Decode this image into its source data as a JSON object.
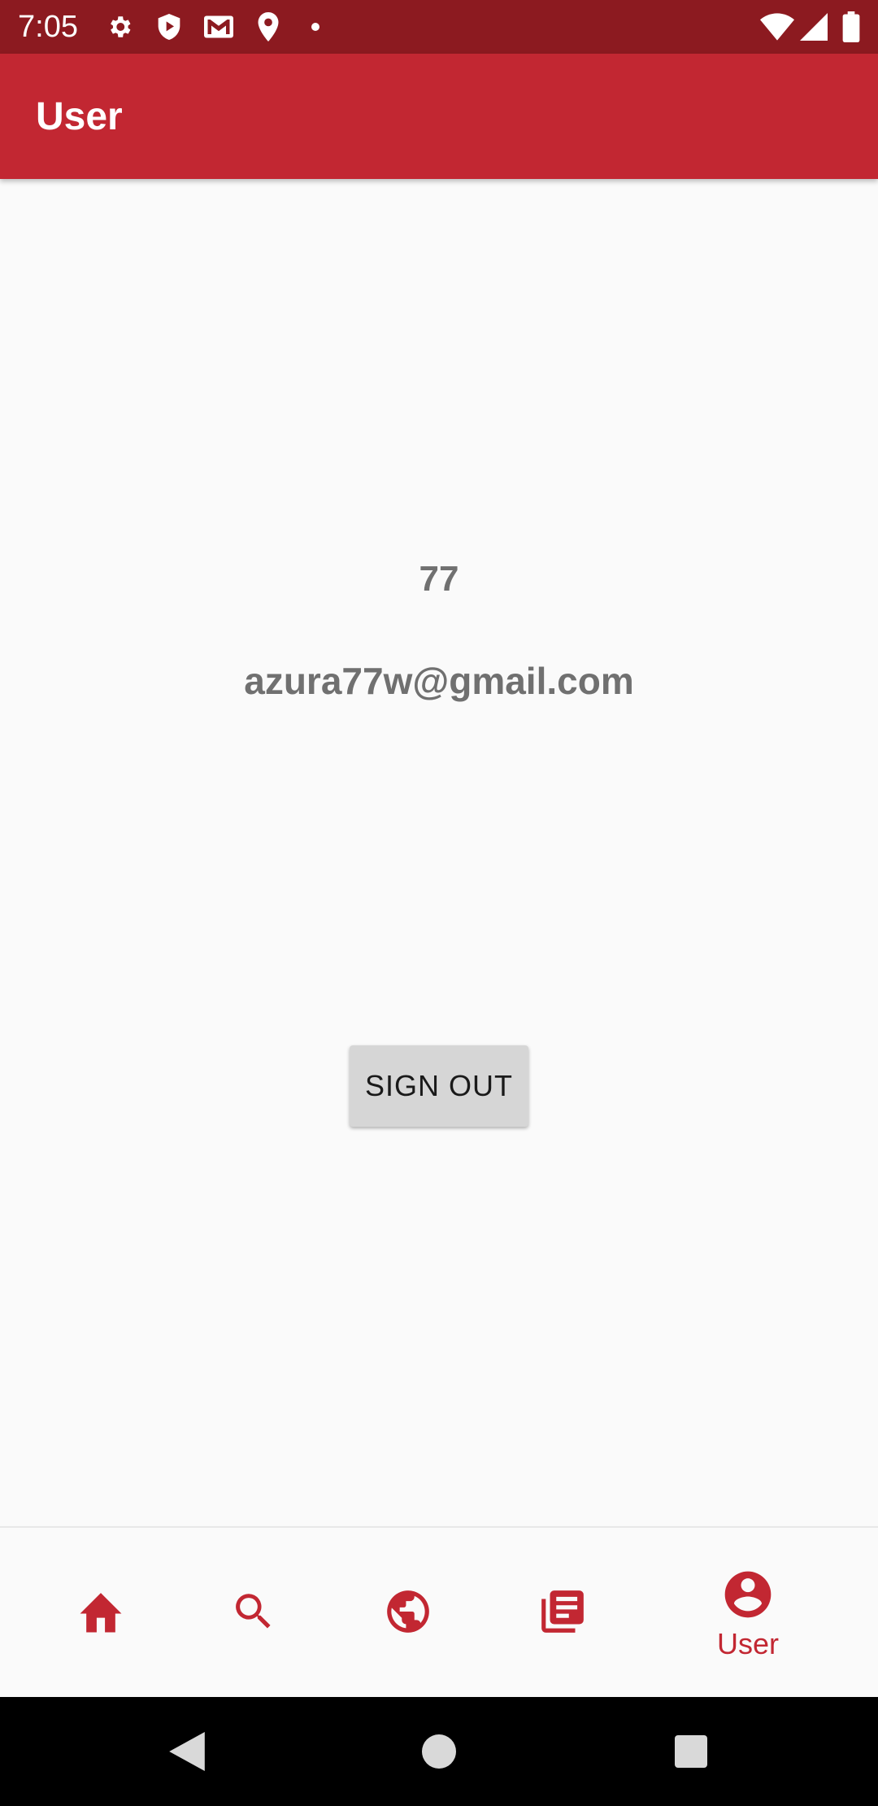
{
  "status_bar": {
    "time": "7:05",
    "icons": [
      "gear-icon",
      "shield-play-icon",
      "gmail-icon",
      "location-icon",
      "notification-dot-icon",
      "wifi-icon",
      "signal-icon",
      "battery-icon"
    ]
  },
  "app_bar": {
    "title": "User"
  },
  "profile": {
    "name": "77",
    "email": "azura77w@gmail.com",
    "sign_out_label": "SIGN OUT"
  },
  "bottom_nav": {
    "items": [
      {
        "icon": "home-icon",
        "label": ""
      },
      {
        "icon": "search-icon",
        "label": ""
      },
      {
        "icon": "globe-icon",
        "label": ""
      },
      {
        "icon": "news-icon",
        "label": ""
      },
      {
        "icon": "account-icon",
        "label": "User"
      }
    ],
    "active_index": 4
  },
  "colors": {
    "primary": "#c22732",
    "primary_dark": "#8c1a20",
    "text_secondary": "#707070",
    "button_bg": "#d6d6d6"
  }
}
